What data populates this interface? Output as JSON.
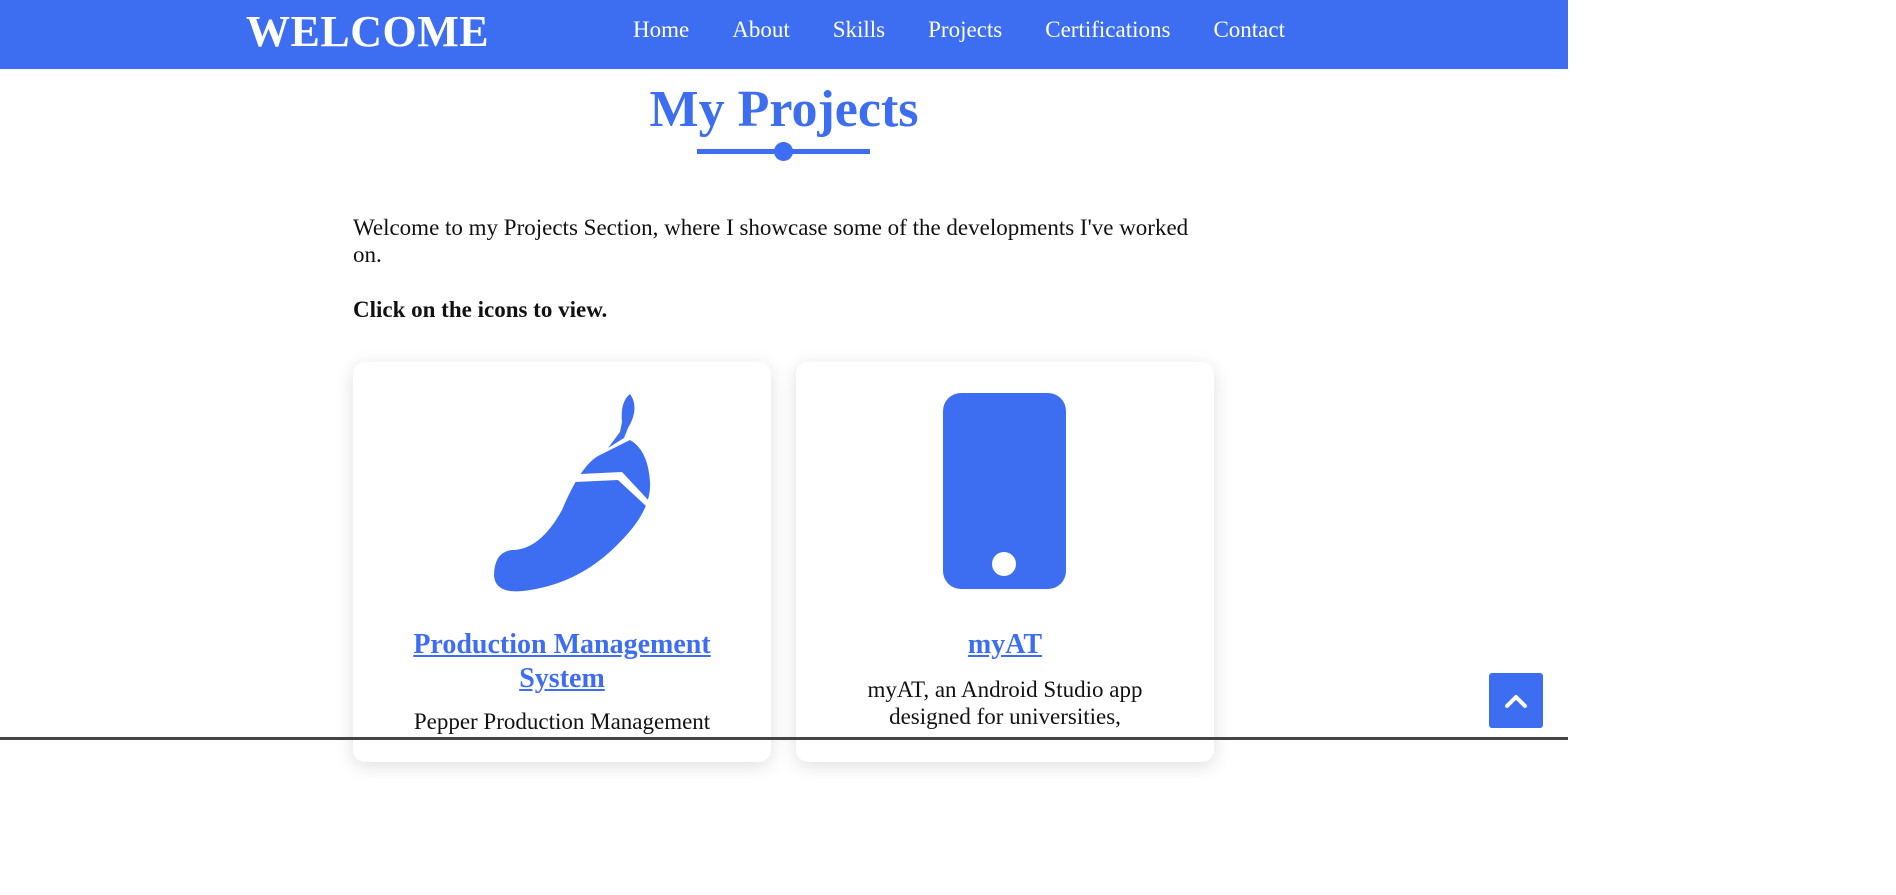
{
  "navbar": {
    "brand": "WELCOME",
    "links": [
      "Home",
      "About",
      "Skills",
      "Projects",
      "Certifications",
      "Contact"
    ]
  },
  "section": {
    "title": "My Projects",
    "intro": "Welcome to my Projects Section, where I showcase some of  the developments I've worked on.",
    "cta": "Click on the icons to view."
  },
  "projects": [
    {
      "icon": "pepper-icon",
      "title": "Production Management System",
      "description": "Pepper Production Management"
    },
    {
      "icon": "mobile-phone-icon",
      "title": "myAT",
      "description": "myAT, an Android Studio app designed for universities,"
    }
  ],
  "scroll_top": {
    "icon": "chevron-up-icon"
  },
  "colors": {
    "accent": "#3d6ef2",
    "text": "#111111",
    "background": "#ffffff"
  }
}
